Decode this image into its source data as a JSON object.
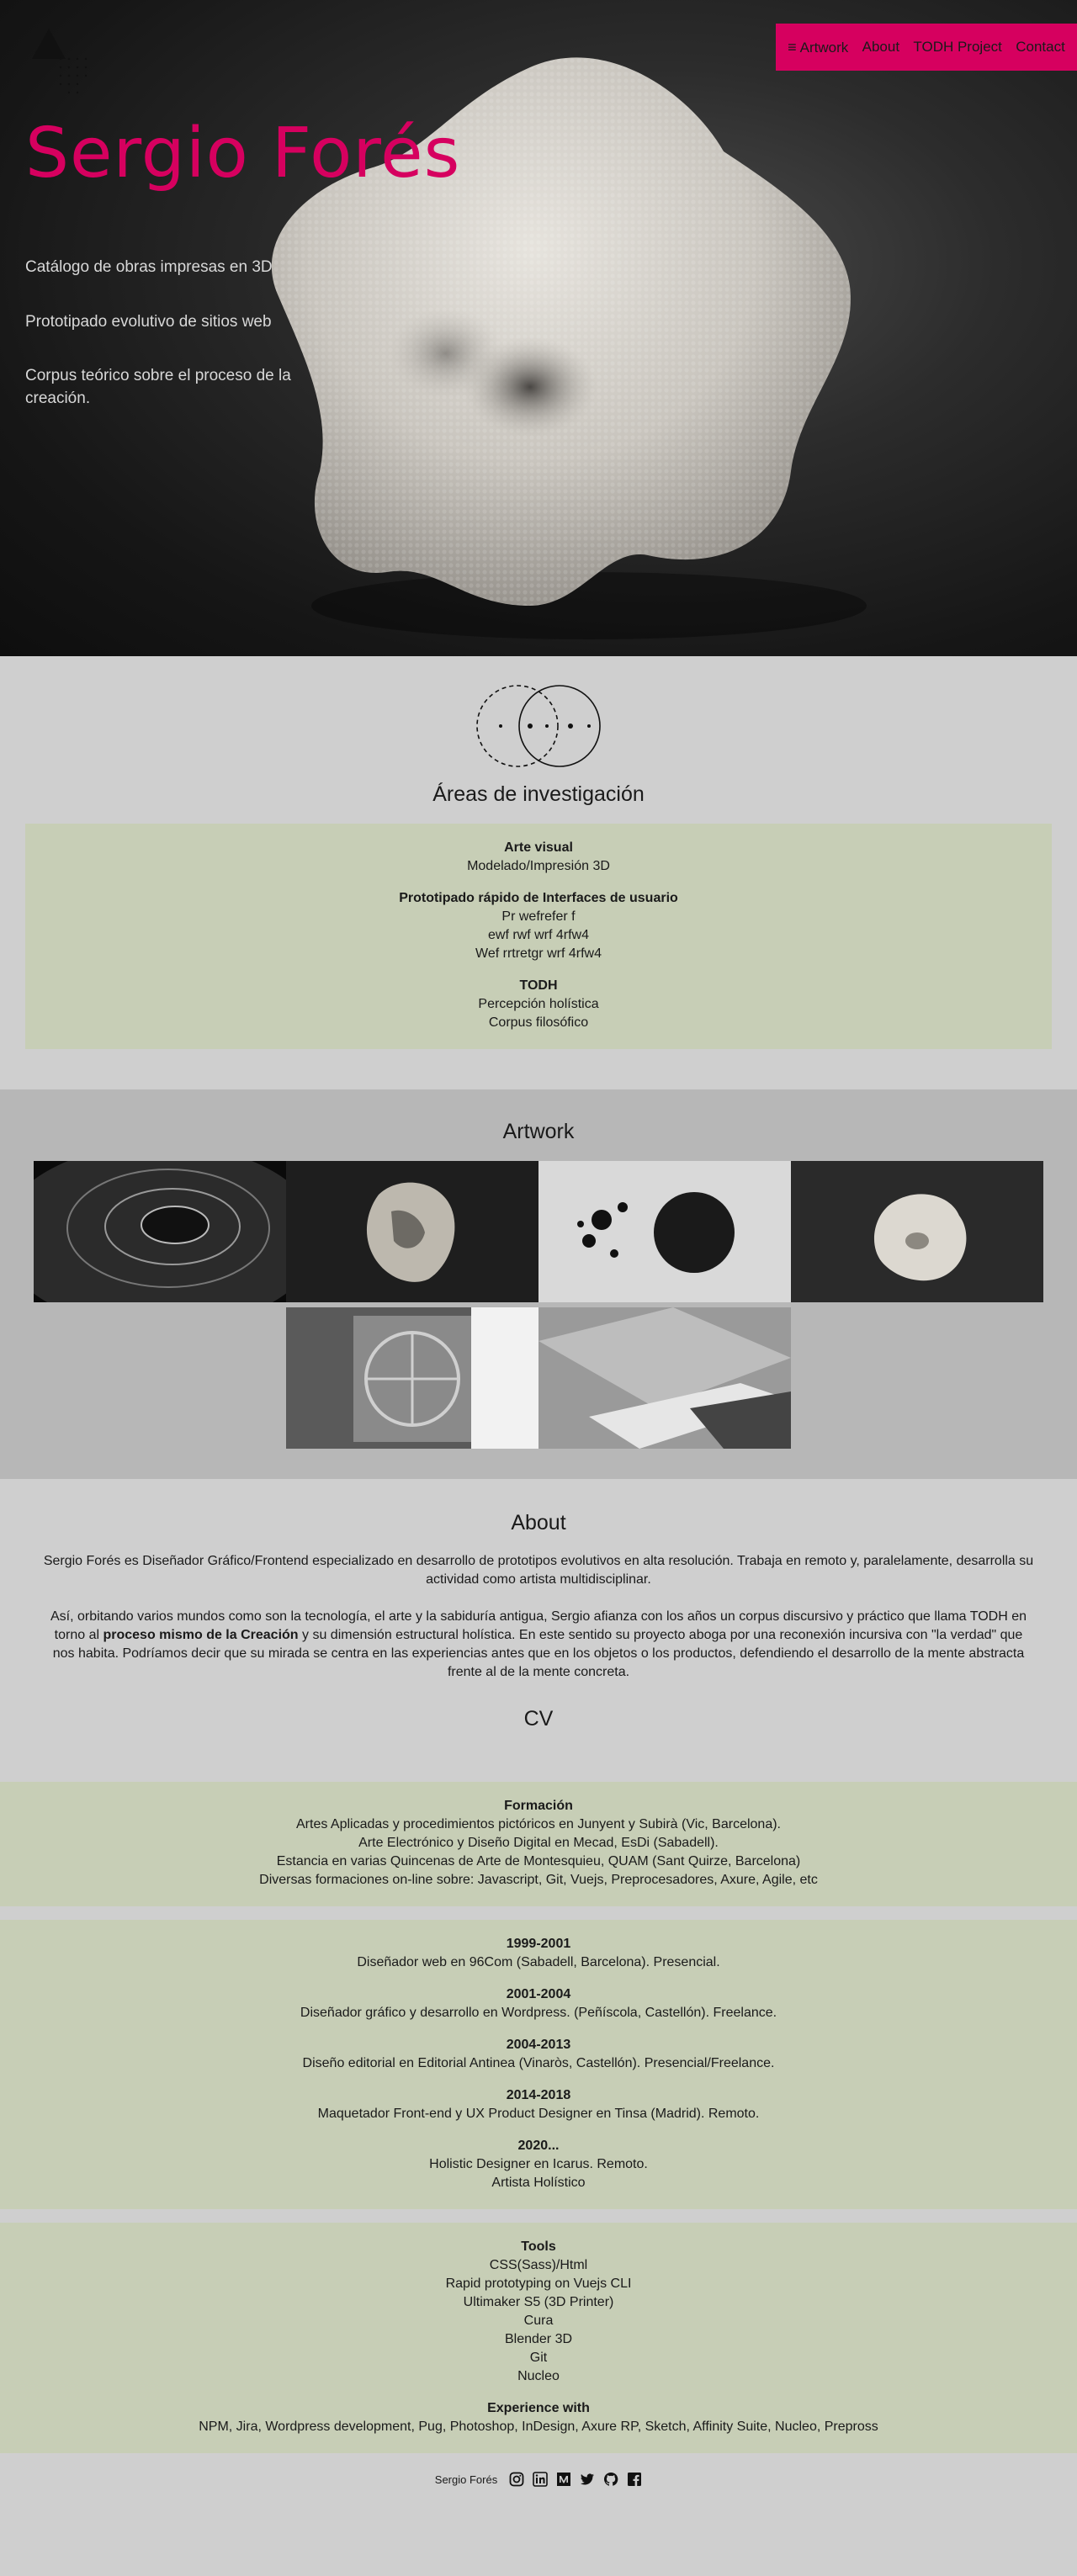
{
  "hero": {
    "title": "Sergio Forés",
    "lines": [
      "Catálogo de obras impresas en 3D",
      "Prototipado evolutivo de sitios web",
      "Corpus teórico sobre el proceso de la creación."
    ]
  },
  "nav": {
    "menu_icon": "≡",
    "items": [
      "Artwork",
      "About",
      "TODH Project",
      "Contact"
    ]
  },
  "research": {
    "title": "Áreas de investigación",
    "groups": [
      {
        "heading": "Arte visual",
        "items": [
          "Modelado/Impresión 3D"
        ]
      },
      {
        "heading": "Prototipado rápido de Interfaces de usuario",
        "items": [
          "Pr wefrefer f",
          "ewf rwf wrf 4rfw4",
          "Wef rrtretgr wrf 4rfw4"
        ]
      },
      {
        "heading": "TODH",
        "items": [
          "Percepción holística",
          "Corpus filosófico"
        ]
      }
    ]
  },
  "artwork": {
    "title": "Artwork"
  },
  "about": {
    "title": "About",
    "p1": "Sergio Forés es Diseñador Gráfico/Frontend especializado en desarrollo de prototipos evolutivos en alta resolución. Trabaja en remoto y, paralelamente, desarrolla su actividad como artista multidisciplinar.",
    "p2_a": "Así, orbitando varios mundos como son la tecnología, el arte y la sabiduría antigua, Sergio afianza con los años un corpus discursivo y práctico que llama TODH en torno al ",
    "p2_bold": "proceso mismo de la Creación",
    "p2_b": " y su dimensión estructural holística. En este sentido su proyecto aboga por una reconexión incursiva con \"la verdad\" que nos habita. Podríamos decir que su mirada se centra en las experiencias antes que en los objetos o los productos, defendiendo el desarrollo de la mente abstracta frente al de la mente concreta."
  },
  "cv": {
    "title": "CV",
    "formacion": {
      "heading": "Formación",
      "items": [
        "Artes Aplicadas y procedimientos pictóricos en Junyent y Subirà (Vic, Barcelona).",
        "Arte Electrónico y Diseño Digital en Mecad, EsDi (Sabadell).",
        "Estancia en varias Quincenas de Arte de Montesquieu, QUAM (Sant Quirze, Barcelona)",
        "Diversas formaciones on-line sobre: Javascript, Git, Vuejs, Preprocesadores, Axure, Agile, etc"
      ]
    },
    "experience": [
      {
        "heading": "1999-2001",
        "items": [
          "Diseñador web en 96Com (Sabadell, Barcelona). Presencial."
        ]
      },
      {
        "heading": "2001-2004",
        "items": [
          "Diseñador gráfico y desarrollo en Wordpress. (Peñíscola, Castellón). Freelance."
        ]
      },
      {
        "heading": "2004-2013",
        "items": [
          "Diseño editorial en Editorial Antinea (Vinaròs, Castellón). Presencial/Freelance."
        ]
      },
      {
        "heading": "2014-2018",
        "items": [
          "Maquetador Front-end y UX Product Designer en Tinsa (Madrid). Remoto."
        ]
      },
      {
        "heading": "2020...",
        "items": [
          "Holistic Designer en Icarus. Remoto.",
          "Artista Holístico"
        ]
      }
    ],
    "tools": [
      {
        "heading": "Tools",
        "items": [
          "CSS(Sass)/Html",
          "Rapid prototyping on Vuejs CLI",
          "Ultimaker S5 (3D Printer)",
          "Cura",
          "Blender 3D",
          "Git",
          "Nucleo"
        ]
      },
      {
        "heading": "Experience with",
        "items": [
          "NPM, Jira, Wordpress development, Pug, Photoshop, InDesign, Axure RP, Sketch, Affinity Suite, Nucleo, Prepross"
        ]
      }
    ]
  },
  "footer": {
    "name": "Sergio Forés",
    "icons": [
      "instagram-icon",
      "linkedin-icon",
      "medium-icon",
      "twitter-icon",
      "github-icon",
      "facebook-icon"
    ]
  },
  "colors": {
    "accent": "#d6005f",
    "green_box": "#c7ceb6",
    "page_bg": "#cfcfcf",
    "artwork_bg": "#b7b7b7"
  }
}
